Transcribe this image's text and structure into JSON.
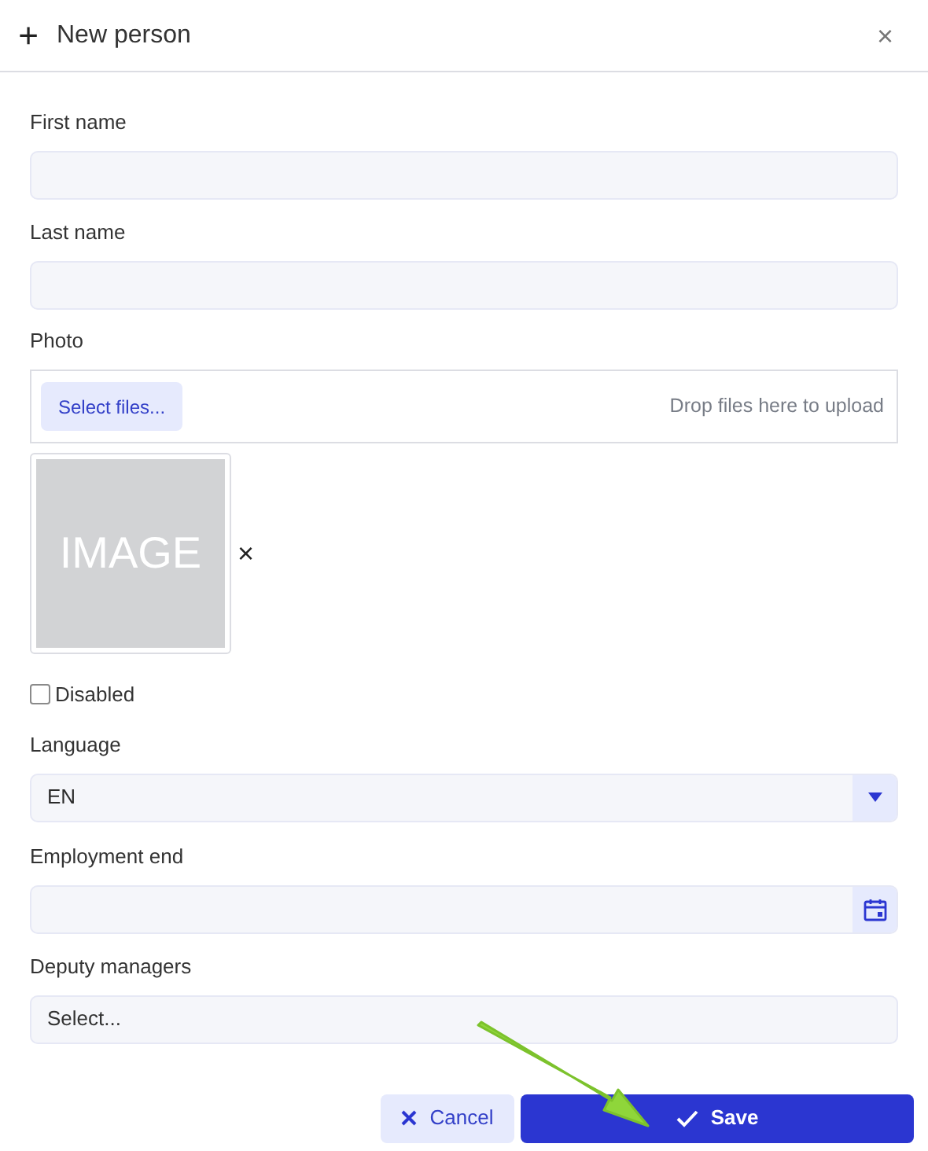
{
  "window": {
    "title": "New person",
    "icon": "+",
    "close": "×"
  },
  "fields": [
    {
      "kind": "text",
      "label": "First name"
    },
    {
      "kind": "text",
      "label": "Last name"
    },
    {
      "kind": "upload",
      "label": "Photo",
      "button": "Select files...",
      "hint": "Drop files here to upload",
      "thumbnail": {
        "text": "IMAGE",
        "remove": "×"
      }
    },
    {
      "kind": "checkbox",
      "label": "Disabled",
      "checked": false
    },
    {
      "kind": "select",
      "label": "Language",
      "value": "EN"
    },
    {
      "kind": "date",
      "label": "Employment end"
    },
    {
      "kind": "multiselect",
      "label": "Deputy managers",
      "placeholder": "Select..."
    }
  ],
  "buttons": [
    {
      "kind": "cancel",
      "label": "Cancel"
    },
    {
      "kind": "save",
      "label": "Save"
    }
  ],
  "annotation": {
    "kind": "arrow"
  }
}
